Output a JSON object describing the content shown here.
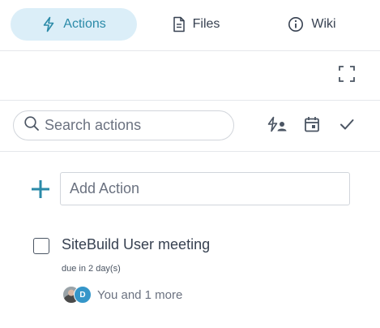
{
  "tabs": [
    {
      "label": "Actions",
      "icon": "lightning-icon",
      "active": true
    },
    {
      "label": "Files",
      "icon": "file-icon",
      "active": false
    },
    {
      "label": "Wiki",
      "icon": "info-icon",
      "active": false
    }
  ],
  "toolbar": {
    "expand_icon": "expand-icon"
  },
  "search": {
    "placeholder": "Search actions",
    "value": ""
  },
  "filters": [
    {
      "name": "assigned-to-me",
      "icon": "lightning-user-icon"
    },
    {
      "name": "due-date",
      "icon": "calendar-icon"
    },
    {
      "name": "completed",
      "icon": "check-icon"
    }
  ],
  "add_action": {
    "placeholder": "Add Action",
    "value": ""
  },
  "actions": [
    {
      "title": "SiteBuild User meeting",
      "due": "due in 2 day(s)",
      "avatar_initial": "D",
      "assignees": "You and 1 more",
      "checked": false
    }
  ],
  "colors": {
    "accent": "#2a8aa8",
    "active_tab_bg": "#dbeef8",
    "avatar_blue": "#3596c9",
    "text": "#374151",
    "border": "#d1d5db"
  }
}
